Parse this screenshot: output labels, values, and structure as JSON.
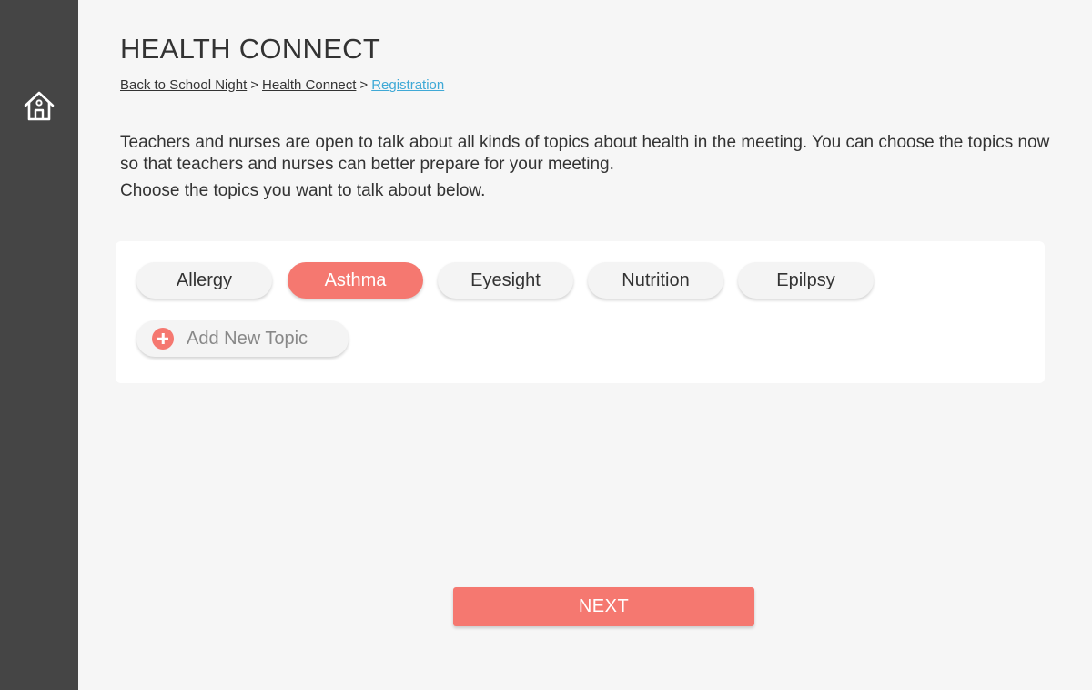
{
  "app": {
    "title": "HEALTH CONNECT"
  },
  "sidebar": {
    "home_icon": "home-icon"
  },
  "breadcrumb": {
    "items": [
      "Back to School Night",
      "Health Connect",
      "Registration"
    ],
    "separator": ">"
  },
  "intro": {
    "paragraph1": "Teachers and nurses are open to talk about all kinds of topics about health in the meeting. You can choose the topics now so that teachers and nurses can better prepare for your meeting.",
    "paragraph2": "Choose the topics you want to talk about below."
  },
  "topics": {
    "chips": [
      {
        "label": "Allergy",
        "selected": false
      },
      {
        "label": "Asthma",
        "selected": true
      },
      {
        "label": "Eyesight",
        "selected": false
      },
      {
        "label": "Nutrition",
        "selected": false
      },
      {
        "label": "Epilpsy",
        "selected": false
      }
    ],
    "add_label": "Add New Topic"
  },
  "actions": {
    "next_label": "NEXT"
  },
  "colors": {
    "accent": "#f57870",
    "sidebar": "#454545",
    "link_active": "#3fa9d6",
    "background": "#f6f6f6"
  }
}
